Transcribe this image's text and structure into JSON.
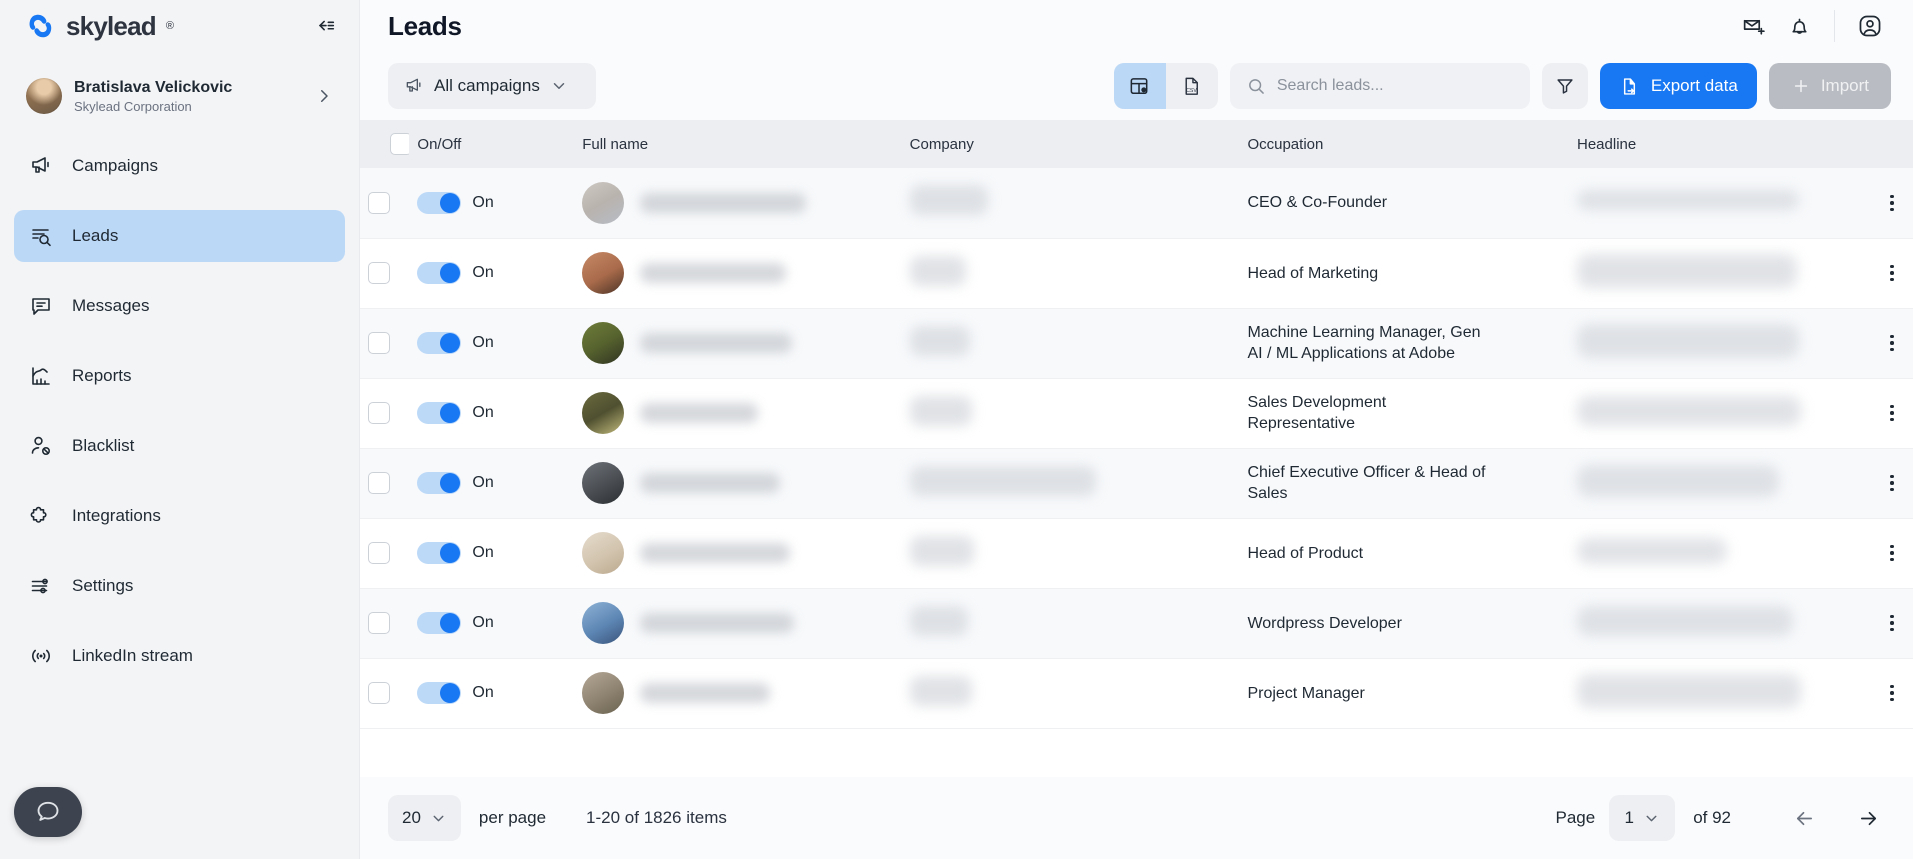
{
  "brand": {
    "name": "skylead",
    "registered_mark": "®",
    "accent_color": "#1877f2",
    "active_nav_color": "#bcd8f7"
  },
  "sidebar": {
    "collapse_icon": "collapse-left-icon",
    "profile": {
      "name": "Bratislava Velickovic",
      "org": "Skylead Corporation",
      "chevron_icon": "chevron-right-icon"
    },
    "items": [
      {
        "label": "Campaigns",
        "icon": "megaphone-icon",
        "active": false
      },
      {
        "label": "Leads",
        "icon": "lead-search-icon",
        "active": true
      },
      {
        "label": "Messages",
        "icon": "chat-lines-icon",
        "active": false
      },
      {
        "label": "Reports",
        "icon": "bar-chart-icon",
        "active": false
      },
      {
        "label": "Blacklist",
        "icon": "user-blocked-icon",
        "active": false
      },
      {
        "label": "Integrations",
        "icon": "puzzle-piece-icon",
        "active": false
      },
      {
        "label": "Settings",
        "icon": "sliders-icon",
        "active": false
      },
      {
        "label": "LinkedIn stream",
        "icon": "broadcast-icon",
        "active": false
      }
    ],
    "chat_widget_icon": "chat-bubble-icon"
  },
  "header": {
    "title": "Leads",
    "icons": [
      {
        "name": "mail-add-icon"
      },
      {
        "name": "bell-icon"
      },
      {
        "name": "user-circle-icon"
      }
    ]
  },
  "toolbar": {
    "campaign_filter": {
      "icon": "megaphone-icon",
      "label": "All campaigns",
      "chevron_icon": "chevron-down-icon"
    },
    "view_toggle": [
      {
        "name": "table-settings-icon",
        "active": true
      },
      {
        "name": "csv-file-icon",
        "active": false
      }
    ],
    "search": {
      "icon": "search-icon",
      "placeholder": "Search leads...",
      "value": ""
    },
    "filter_icon": "funnel-icon",
    "export_button": {
      "label": "Export data",
      "icon": "file-export-icon"
    },
    "import_button": {
      "label": "Import",
      "icon": "plus-icon",
      "disabled": true
    }
  },
  "table": {
    "columns": [
      "On/Off",
      "Full name",
      "Company",
      "Occupation",
      "Headline"
    ],
    "select_all_checked": false,
    "rows": [
      {
        "on_label": "On",
        "toggle_on": true,
        "occupation": "CEO & Co-Founder",
        "avatar": "linear-gradient(150deg,#cfc9c4 0%,#b9b3ae 50%,#b6bcc6 100%)",
        "name_w": 166,
        "company_w": 78,
        "headline_w": 222,
        "headline_h": 20
      },
      {
        "on_label": "On",
        "toggle_on": true,
        "occupation": "Head of Marketing",
        "avatar": "linear-gradient(150deg,#c78a68 0%,#a86a4a 55%,#4b3326 100%)",
        "name_w": 146,
        "company_w": 56,
        "headline_w": 220,
        "headline_h": 34
      },
      {
        "on_label": "On",
        "toggle_on": true,
        "occupation": "Machine Learning Manager, Gen\nAI / ML Applications at Adobe",
        "avatar": "linear-gradient(150deg,#6f7d3a 0%,#57632e 50%,#2f3322 100%)",
        "name_w": 152,
        "company_w": 60,
        "headline_w": 222,
        "headline_h": 34
      },
      {
        "on_label": "On",
        "toggle_on": true,
        "occupation": "Sales Development\nRepresentative",
        "avatar": "linear-gradient(150deg,#6b6a3f 0%,#4f5030 50%,#c3bb7d 100%)",
        "name_w": 118,
        "company_w": 62,
        "headline_w": 224,
        "headline_h": 30
      },
      {
        "on_label": "On",
        "toggle_on": true,
        "occupation": "Chief Executive Officer & Head of\nSales",
        "avatar": "linear-gradient(150deg,#6d7278 0%,#4a4e53 55%,#2b2e31 100%)",
        "name_w": 140,
        "company_w": 186,
        "headline_w": 202,
        "headline_h": 32
      },
      {
        "on_label": "On",
        "toggle_on": true,
        "occupation": "Head of Product",
        "avatar": "linear-gradient(150deg,#e6dccd 0%,#d2c4ae 55%,#bca98f 100%)",
        "name_w": 150,
        "company_w": 64,
        "headline_w": 150,
        "headline_h": 26
      },
      {
        "on_label": "On",
        "toggle_on": true,
        "occupation": "Wordpress Developer",
        "avatar": "linear-gradient(150deg,#8fb3d6 0%,#5d86b4 55%,#39537a 100%)",
        "name_w": 154,
        "company_w": 58,
        "headline_w": 216,
        "headline_h": 30
      },
      {
        "on_label": "On",
        "toggle_on": true,
        "occupation": "Project Manager",
        "avatar": "linear-gradient(150deg,#b5a896 0%,#8e8270 55%,#6a6250 100%)",
        "name_w": 130,
        "company_w": 62,
        "headline_w": 224,
        "headline_h": 34
      }
    ],
    "row_action_icon": "kebab-menu-icon"
  },
  "footer": {
    "per_page_value": "20",
    "per_page_chevron": "chevron-down-icon",
    "per_page_label": "per page",
    "range_text": "1-20 of 1826 items",
    "page_label": "Page",
    "page_value": "1",
    "page_chevron": "chevron-down-icon",
    "of_pages": "of 92",
    "prev_icon": "arrow-left-icon",
    "next_icon": "arrow-right-icon"
  }
}
